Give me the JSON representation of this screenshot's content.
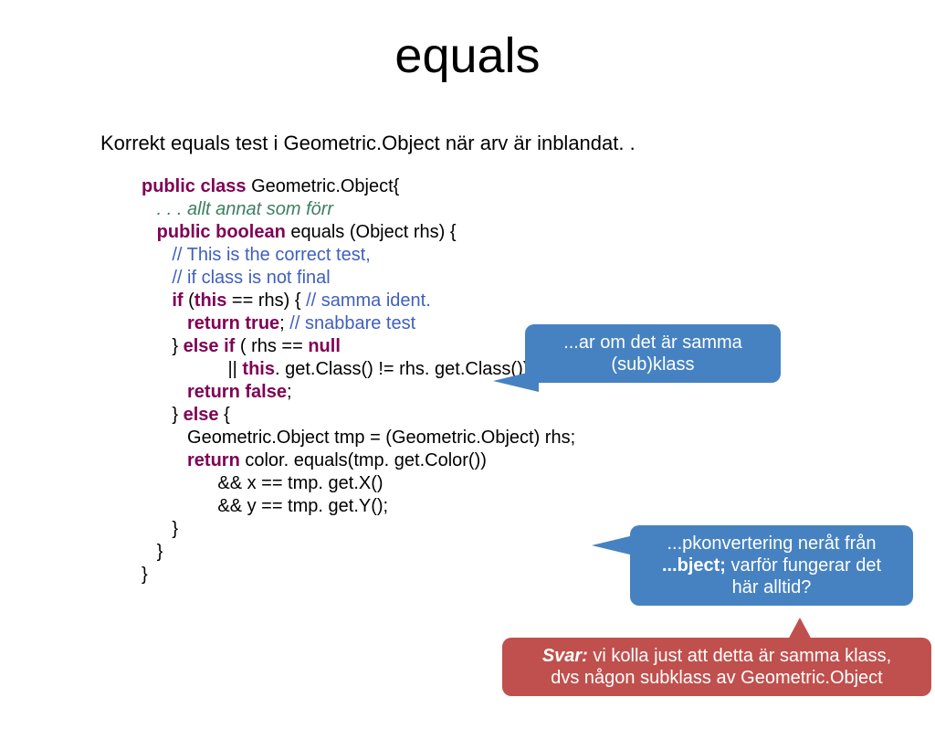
{
  "title": "equals",
  "subtitle": "Korrekt equals test i Geometric.Object när arv är inblandat. .",
  "code": {
    "l1a": "public",
    "l1b": " ",
    "l1c": "class",
    "l1d": " Geometric.Object{",
    "l2": "   . . . allt annat som förr",
    "l3a": "   ",
    "l3b": "public",
    "l3c": " ",
    "l3d": "boolean",
    "l3e": " equals (Object rhs) {",
    "l4": "      // This is the correct test,",
    "l5": "      // if class is not final",
    "l6a": "      ",
    "l6b": "if",
    "l6c": " (",
    "l6d": "this",
    "l6e": " == rhs) { ",
    "l6f": "// samma ident.",
    "l7a": "         ",
    "l7b": "return",
    "l7c": " ",
    "l7d": "true",
    "l7e": "; ",
    "l7f": "// snabbare test",
    "l8a": "      } ",
    "l8b": "else",
    "l8c": " ",
    "l8d": "if",
    "l8e": " ( rhs == ",
    "l8f": "null",
    "l9a": "                 || ",
    "l9b": "this",
    "l9c": ". get.Class() != rhs. get.Class()) {",
    "l10a": "         ",
    "l10b": "return",
    "l10c": " ",
    "l10d": "false",
    "l10e": ";",
    "l11a": "      } ",
    "l11b": "else",
    "l11c": " {",
    "l12": "         Geometric.Object tmp = (Geometric.Object) rhs;",
    "l13a": "         ",
    "l13b": "return",
    "l13c": " color. equals(tmp. get.Color())",
    "l14": "               && x == tmp. get.X()",
    "l15": "               && y == tmp. get.Y();",
    "l16": "      }",
    "l17": "   }",
    "l18": "}"
  },
  "callout1": {
    "l1": "...ar om det är samma",
    "l2": "(sub)klass"
  },
  "callout2": {
    "l1": "...pkonvertering neråt från",
    "l2a": "...bject;",
    "l2b": " varför fungerar det",
    "l3": "här alltid?"
  },
  "callout3": {
    "l1a": "Svar:",
    "l1b": " vi kolla just att detta är samma klass,",
    "l2": "dvs någon subklass av Geometric.Object"
  }
}
